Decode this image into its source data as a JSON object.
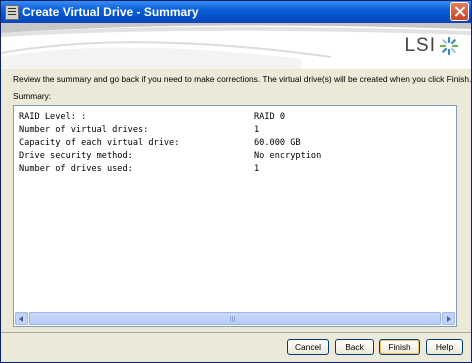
{
  "window": {
    "title": "Create Virtual Drive - Summary",
    "close_label": "Close"
  },
  "header": {
    "logo_text": "LSI"
  },
  "intro_text": "Review the summary and go back if you need to make corrections. The virtual drive(s) will be created when you click Finish.",
  "summary_label": "Summary:",
  "summary_rows": [
    {
      "label": "RAID Level: :",
      "value": "RAID 0"
    },
    {
      "label": "Number of virtual drives:",
      "value": "1"
    },
    {
      "label": "Capacity of each virtual drive:",
      "value": "60.000 GB"
    },
    {
      "label": "Drive security method:",
      "value": "No encryption"
    },
    {
      "label": "Number of drives used:",
      "value": "1"
    }
  ],
  "buttons": {
    "cancel": "Cancel",
    "back": "Back",
    "finish": "Finish",
    "help": "Help"
  },
  "colors": {
    "titlebar": "#0a5fd8",
    "dialog_bg": "#ece9d8",
    "logo_blue": "#3a86c8"
  },
  "icons": {
    "window_icon": "window-list-icon",
    "close": "close-icon",
    "logo": "lsi-starburst-icon"
  }
}
